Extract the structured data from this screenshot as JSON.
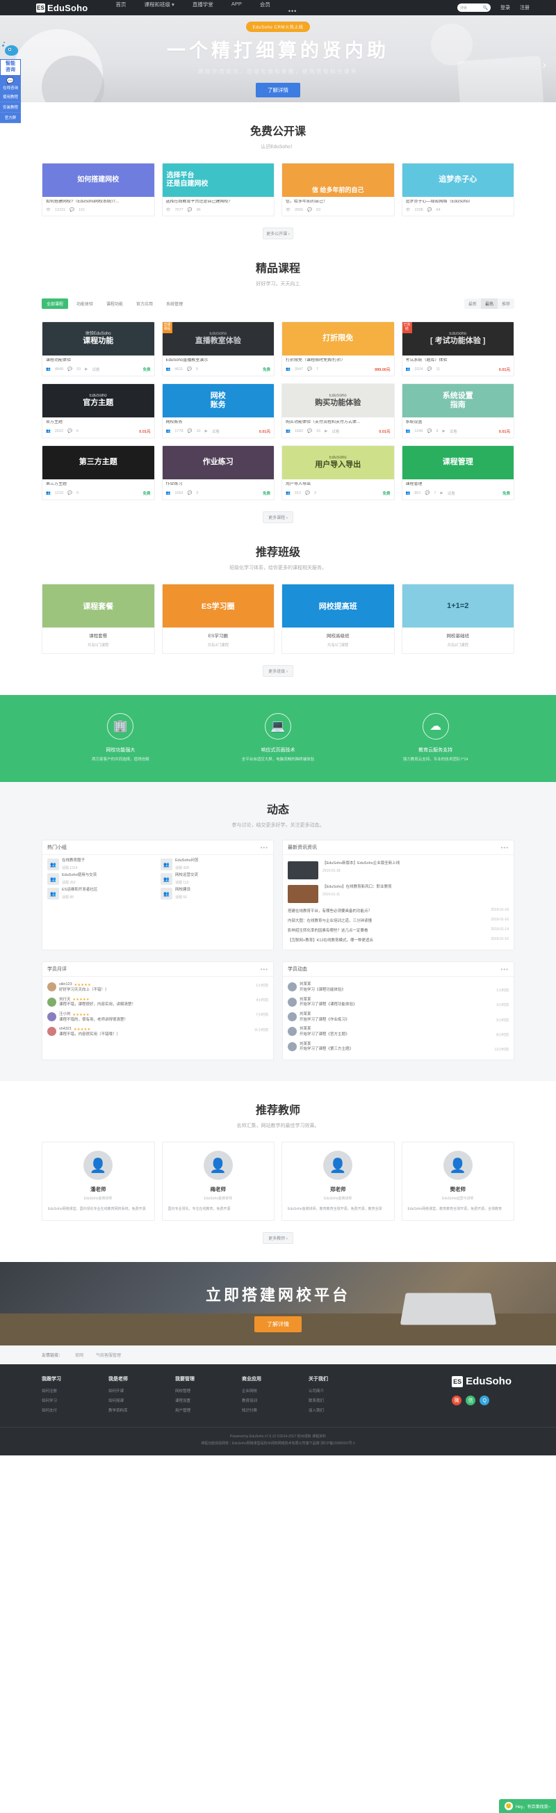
{
  "header": {
    "brand": "EduSoho",
    "logo_mark": "ES",
    "nav": [
      {
        "label": "首页"
      },
      {
        "label": "课程和班级 ▾"
      },
      {
        "label": "直播学堂"
      },
      {
        "label": "APP"
      },
      {
        "label": "会员"
      },
      {
        "label": "•••"
      }
    ],
    "search_placeholder": "搜索",
    "search_icon": "search-icon",
    "login": "登录",
    "register": "注册"
  },
  "sidewidget": {
    "title": "智能\n咨询",
    "title_line1": "智能",
    "title_line2": "咨询",
    "chat_label": "在线咨询",
    "items": [
      {
        "label": "使用教程"
      },
      {
        "label": "安装教程"
      },
      {
        "label": "官方群"
      }
    ]
  },
  "hero": {
    "badge": "EduSoho CRM火热上线",
    "title": "一个精打细算的贤内助",
    "subtitle": "跟踪学员情况，自动化通知唤醒，提高营收和完课率",
    "button": "了解详情",
    "dots": 5,
    "active_dot": 1,
    "arrow_left": "‹",
    "arrow_right": "›"
  },
  "open_courses": {
    "title": "免费公开课",
    "subtitle": "认识EduSoho！",
    "more": "更多公开课 ›",
    "items": [
      {
        "art_title": "如何搭建网校",
        "title": "如何搭建网校?（EduSoho网校系统介...",
        "views": "12231",
        "comments": "151",
        "bg": "#6f7ede",
        "fg": "#ffffff"
      },
      {
        "art_title": "选择平台\n还是自建网校",
        "art_line1": "选择平台",
        "art_line2": "还是自建网校",
        "title": "选择在线教育平台还是自己建网校？",
        "views": "7077",
        "comments": "96",
        "bg": "#3dc2c8",
        "fg": "#ffffff"
      },
      {
        "art_title": "信 给多年前的自己",
        "title": "信，给多年前的自己！",
        "views": "2656",
        "comments": "63",
        "bg": "#f2a13f",
        "fg": "#ffffff"
      },
      {
        "art_title": "追梦赤子心",
        "title": "追梦赤子心—绎知网络（EduSoho）",
        "views": "2298",
        "comments": "64",
        "bg": "#5fc6e0",
        "fg": "#ffffff"
      }
    ]
  },
  "premium": {
    "title": "精品课程",
    "subtitle": "好好学习，天天向上",
    "tabs": [
      {
        "label": "全部课程",
        "active": true
      },
      {
        "label": "功能体验",
        "active": false
      },
      {
        "label": "课程功能",
        "active": false
      },
      {
        "label": "官方应用",
        "active": false
      },
      {
        "label": "系统管理",
        "active": false
      }
    ],
    "sorts": [
      {
        "label": "最新",
        "active": false
      },
      {
        "label": "最热",
        "active": true
      },
      {
        "label": "推荐",
        "active": false
      }
    ],
    "more": "更多课程 ›",
    "accent": "#3dbe75",
    "courses": [
      {
        "art_top": "体验EduSoho",
        "art_main": "课程功能",
        "title": "课程功能体验",
        "students": "4849",
        "comments": "33",
        "trial": "试看",
        "price": "免费",
        "price_type": "free",
        "bg": "#2f3a40",
        "fg": "#ffffff",
        "badge": "",
        "badge_bg": ""
      },
      {
        "art_top": "EduSoho",
        "art_main": "直播教室体验",
        "title": "EduSoho直播教室演示",
        "students": "4611",
        "comments": "9",
        "trial": "",
        "price": "免费",
        "price_type": "free",
        "bg": "#2e3135",
        "fg": "#c9ccd0",
        "badge": "直播课程",
        "badge_bg": "#f0932b"
      },
      {
        "art_top": "",
        "art_main": "打折限免",
        "title": "打折限免（课程限时免费/打折）",
        "students": "3947",
        "comments": "7",
        "trial": "",
        "price": "999.00元",
        "price_type": "pay",
        "bg": "#f5b041",
        "fg": "#ffffff",
        "badge": "",
        "badge_bg": ""
      },
      {
        "art_top": "EduSoho",
        "art_main": "[ 考试功能体验 ]",
        "title": "考试系统（题库）体验",
        "students": "3324",
        "comments": "11",
        "trial": "",
        "price": "0.01元",
        "price_type": "pay",
        "bg": "#2b2b2b",
        "fg": "#e8e8e8",
        "badge": "已完结",
        "badge_bg": "#e8503a"
      },
      {
        "art_top": "EduSoho",
        "art_main": "官方主题",
        "title": "官方主题",
        "students": "2022",
        "comments": "6",
        "trial": "",
        "price": "0.01元",
        "price_type": "pay",
        "bg": "#22262b",
        "fg": "#ffffff",
        "badge": "",
        "badge_bg": ""
      },
      {
        "art_top": "",
        "art_main": "网校\n账务",
        "title": "网校账务",
        "students": "1778",
        "comments": "10",
        "trial": "试看",
        "price": "0.01元",
        "price_type": "pay",
        "bg": "#1c8fd6",
        "fg": "#ffffff",
        "badge": "",
        "badge_bg": ""
      },
      {
        "art_top": "EduSoho",
        "art_main": "购买功能体验",
        "title": "购买功能体验（支付流程和支付方式体...",
        "students": "1683",
        "comments": "15",
        "trial": "试看",
        "price": "0.01元",
        "price_type": "pay",
        "bg": "#e8e8e4",
        "fg": "#4a4a4a",
        "badge": "",
        "badge_bg": ""
      },
      {
        "art_top": "",
        "art_main": "系统设置\n指南",
        "title": "系统设置",
        "students": "1246",
        "comments": "9",
        "trial": "试看",
        "price": "0.01元",
        "price_type": "pay",
        "bg": "#7cc4ae",
        "fg": "#ffffff",
        "badge": "",
        "badge_bg": ""
      },
      {
        "art_top": "",
        "art_main": "第三方主题",
        "title": "第三方主题",
        "students": "1219",
        "comments": "9",
        "trial": "",
        "price": "免费",
        "price_type": "free",
        "bg": "#1c1c1c",
        "fg": "#ffffff",
        "badge": "",
        "badge_bg": ""
      },
      {
        "art_top": "",
        "art_main": "作业练习",
        "title": "作业练习",
        "students": "1063",
        "comments": "5",
        "trial": "",
        "price": "免费",
        "price_type": "free",
        "bg": "#514058",
        "fg": "#ffffff",
        "badge": "",
        "badge_bg": ""
      },
      {
        "art_top": "EduSoho",
        "art_main": "用户导入导出",
        "title": "用户导入导出",
        "students": "912",
        "comments": "3",
        "trial": "",
        "price": "免费",
        "price_type": "free",
        "bg": "#cfe08a",
        "fg": "#3c4a1e",
        "badge": "",
        "badge_bg": ""
      },
      {
        "art_top": "",
        "art_main": "课程管理",
        "title": "课程管理",
        "students": "801",
        "comments": "7",
        "trial": "试看",
        "price": "免费",
        "price_type": "free",
        "bg": "#2aaf5f",
        "fg": "#ffffff",
        "badge": "",
        "badge_bg": ""
      }
    ]
  },
  "classes": {
    "title": "推荐班级",
    "subtitle": "班级化学习体系，给你更多的课程相关服务。",
    "more": "更多班级 ›",
    "items": [
      {
        "art": "课程套餐",
        "name": "课程套餐",
        "count": "共有5门课程",
        "bg": "#9cc47d",
        "fg": "#ffffff"
      },
      {
        "art": "ES学习圈",
        "name": "ES学习圈",
        "count": "共有4门课程",
        "bg": "#f0922e",
        "fg": "#ffffff"
      },
      {
        "art": "网校提高班",
        "name": "网校高级班",
        "count": "共有5门课程",
        "bg": "#1b8fd8",
        "fg": "#ffffff"
      },
      {
        "art": "1+1=2",
        "name": "网校基础班",
        "count": "共有8门课程",
        "bg": "#84cde2",
        "fg": "#184e63"
      }
    ]
  },
  "features": {
    "bg": "#3dbe75",
    "items": [
      {
        "icon": "building-icon",
        "glyph": "🏢",
        "title": "网校功能强大",
        "desc": "两万家客户的共同选择，值得信赖"
      },
      {
        "icon": "laptop-icon",
        "glyph": "💻",
        "title": "响应式页面技术",
        "desc": "全平台自适应大屏，电脑流畅的跨终端体验"
      },
      {
        "icon": "cloud-check-icon",
        "glyph": "☁",
        "title": "教育云服务支持",
        "desc": "强力教育云支持，专业的技术团队7*24"
      }
    ]
  },
  "dynamic": {
    "title": "动态",
    "subtitle": "参与讨论，结交更多好学，关注更多动态。",
    "groups_panel": {
      "header": "热门小组",
      "more_icon": "•••",
      "items": [
        {
          "avatar": "👥",
          "name": "在线教育圈子",
          "count": "话题 1314"
        },
        {
          "avatar": "👥",
          "name": "EduSoho问答",
          "count": "话题 428"
        },
        {
          "avatar": "👥",
          "name": "EduSoho使用与交流",
          "count": "话题 262"
        },
        {
          "avatar": "👥",
          "name": "网校运营交流",
          "count": "话题 113"
        },
        {
          "avatar": "👥",
          "name": "ES运维和开发者社区",
          "count": "话题 88"
        },
        {
          "avatar": "👥",
          "name": "网校建设",
          "count": "话题 66"
        }
      ]
    },
    "news_panel": {
      "header": "最新资讯资讯",
      "more_icon": "•••",
      "featured": [
        {
          "title": "【EduSoho新版本】EduSoho企业版全新上线",
          "date": "2019-01-18",
          "bg": "#3a3f45"
        },
        {
          "title": "【EduSoho】在线教育新风口：职业教育",
          "date": "2019-01-11",
          "bg": "#8a5a3a"
        }
      ],
      "lines": [
        {
          "text": "搭建在线教育平台，有哪些必须要具备的功能点？",
          "date": "2019-01-18"
        },
        {
          "text": "内部大图：在线教育与企业培训之道，三分钟读懂",
          "date": "2019-01-16"
        },
        {
          "text": "影响招生转化率的因素有哪些？这几点一定要看",
          "date": "2019-01-14"
        },
        {
          "text": "【互联网+教育】K12在线教育模式，哪一种更适合",
          "date": "2019-01-10"
        }
      ]
    },
    "reviews_panel": {
      "header": "学员月评",
      "more_icon": "•••",
      "items": [
        {
          "avatar_bg": "#c8a27a",
          "name": "xilin123",
          "stars": "★★★★★",
          "text": "好好学习天天向上（不错！）",
          "date": "1小时前"
        },
        {
          "avatar_bg": "#7fae6b",
          "name": "刘行天",
          "stars": "★★★★★",
          "text": "课程不错，课程很好，内容实用，讲解清楚！",
          "date": "4小时前"
        },
        {
          "avatar_bg": "#8a7ec0",
          "name": "汪小刘",
          "stars": "★★★★★",
          "text": "课程不错的，很有用，老师讲得很清楚！",
          "date": "7小时前"
        },
        {
          "avatar_bg": "#d07a7a",
          "name": "xh4321",
          "stars": "★★★★★",
          "text": "课程不错，内容很实用（不错哦！）",
          "date": "11小时前"
        }
      ]
    },
    "activity_panel": {
      "header": "学员动态",
      "more_icon": "•••",
      "items": [
        {
          "avatar_bg": "#9aa6b4",
          "name": "刘某某",
          "action": "开始学习《课程功能体验》",
          "date": "1小时前"
        },
        {
          "avatar_bg": "#9aa6b4",
          "name": "刘某某",
          "action": "开始学习了课程《课程功能体验》",
          "date": "3小时前"
        },
        {
          "avatar_bg": "#9aa6b4",
          "name": "刘某某",
          "action": "开始学习了课程《作业练习》",
          "date": "5小时前"
        },
        {
          "avatar_bg": "#9aa6b4",
          "name": "刘某某",
          "action": "开始学习了课程《官方主题》",
          "date": "8小时前"
        },
        {
          "avatar_bg": "#9aa6b4",
          "name": "刘某某",
          "action": "开始学习了课程《第三方主题》",
          "date": "12小时前"
        }
      ]
    }
  },
  "teachers": {
    "title": "推荐教师",
    "subtitle": "名师汇集，网站教学的最佳学习效果。",
    "more": "更多教师 ›",
    "items": [
      {
        "name": "潘老师",
        "sub": "EduSoho金牌讲师",
        "desc": "EduSoho网络课堂，国内领先专业在线教育网校系统，免费开源"
      },
      {
        "name": "梅老师",
        "sub": "EduSoho金牌讲师",
        "desc": "国内专业领先，专注在线教育，免费开源"
      },
      {
        "name": "郑老师",
        "sub": "EduSoho金牌讲师",
        "desc": "EduSoho金牌讲师，教育教育全球开源，免费开源，教育全球"
      },
      {
        "name": "樊老师",
        "sub": "EduSoho运营与讲师",
        "desc": "EduSoho网络课堂，教育教育全球开源，免费开源，全球教育"
      }
    ]
  },
  "cta": {
    "title": "立即搭建网校平台",
    "button": "了解详情"
  },
  "partners": {
    "label": "友情链接：",
    "items": [
      {
        "label": "官网"
      },
      {
        "label": "气校客服管理"
      }
    ]
  },
  "footer": {
    "brand": "EduSoho",
    "logo_mark": "ES",
    "columns": [
      {
        "heading": "我跟学习",
        "links": [
          {
            "label": "如何注册"
          },
          {
            "label": "如何学习"
          },
          {
            "label": "如何支付"
          }
        ]
      },
      {
        "heading": "我是老师",
        "links": [
          {
            "label": "如何开课"
          },
          {
            "label": "如何授课"
          },
          {
            "label": "教学资料库"
          }
        ]
      },
      {
        "heading": "我要管理",
        "links": [
          {
            "label": "网校管理"
          },
          {
            "label": "课程设置"
          },
          {
            "label": "用户管理"
          }
        ]
      },
      {
        "heading": "商业应用",
        "links": [
          {
            "label": "企业网校"
          },
          {
            "label": "教育培训"
          },
          {
            "label": "知识付费"
          }
        ]
      },
      {
        "heading": "关于我们",
        "links": [
          {
            "label": "公司简介"
          },
          {
            "label": "联系我们"
          },
          {
            "label": "加入我们"
          }
        ]
      }
    ],
    "socials": [
      {
        "icon": "weibo-icon",
        "glyph": "微",
        "bg": "#e8503a"
      },
      {
        "icon": "wechat-icon",
        "glyph": "信",
        "bg": "#3dbe75"
      },
      {
        "icon": "qq-icon",
        "glyph": "Q",
        "bg": "#35a4dd"
      }
    ],
    "copyright_line1": "Powered by EduSoho v7.5.12 ©2014-2017  杭州阔知  课程资料",
    "copyright_line2": "课程功能体验网校｜EduSoho网络课堂是杭州阔知网络技术有限公司旗下品牌  浙ICP备15006931号-1"
  },
  "chatbar": {
    "avatar": "🙂",
    "text": "Hey，有百事找我~"
  }
}
